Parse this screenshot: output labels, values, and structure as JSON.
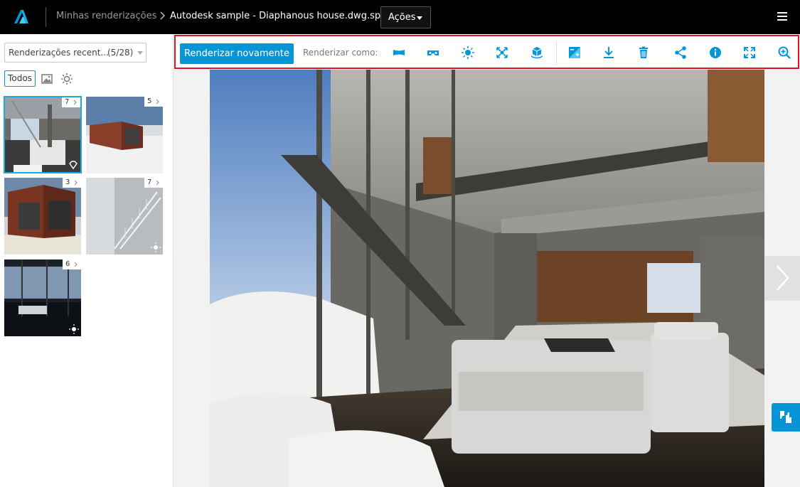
{
  "header": {
    "breadcrumb_root": "Minhas renderizações",
    "breadcrumb_current": "Autodesk sample - Diaphanous house.dwg.spd",
    "actions_label": "Ações"
  },
  "sidebar": {
    "filter_label": "Renderizações recent...",
    "filter_count": "(5/28)",
    "all_label": "Todos",
    "thumbnails": [
      {
        "count": "7"
      },
      {
        "count": "5"
      },
      {
        "count": "3"
      },
      {
        "count": "7"
      },
      {
        "count": "6"
      }
    ]
  },
  "toolbar": {
    "render_again_label": "Renderizar novamente",
    "render_as_label": "Renderizar como:",
    "icons": [
      "panorama-icon",
      "stereo-panorama-icon",
      "illuminance-icon",
      "exploration-icon",
      "turntable-icon",
      "adjust-exposure-icon",
      "download-icon",
      "delete-icon",
      "share-icon",
      "info-icon",
      "fullscreen-icon",
      "zoom-in-icon"
    ]
  },
  "colors": {
    "accent": "#0696d7",
    "header_bg": "#000000",
    "highlight_border": "#e0141e"
  }
}
